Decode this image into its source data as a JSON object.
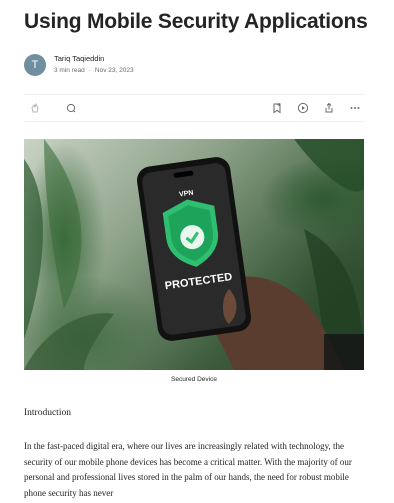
{
  "article": {
    "title": "Using Mobile Security Applications",
    "author": {
      "initial": "T",
      "name": "Tariq Taqieddin",
      "read_time": "3 min read",
      "separator": "·",
      "date": "Nov 23, 2023"
    },
    "toolbar": {
      "icons": [
        "clap-icon",
        "comment-icon",
        "bookmark-icon",
        "listen-icon",
        "share-icon",
        "more-icon"
      ]
    },
    "image": {
      "caption": "Secured Device",
      "screen_text_top": "VPN",
      "screen_text_bottom": "PROTECTED"
    },
    "intro_heading": "Introduction",
    "intro_text": "In the fast-paced digital era, where our lives are increasingly related with technology, the security of our mobile phone devices has become a critical matter. With the majority of our personal and professional lives stored in the palm of our hands, the need for robust mobile phone security has never"
  },
  "colors": {
    "text": "#242424",
    "muted": "#6b6b6b",
    "avatar": "#6f8f9f",
    "shield_green": "#2fbf71"
  }
}
